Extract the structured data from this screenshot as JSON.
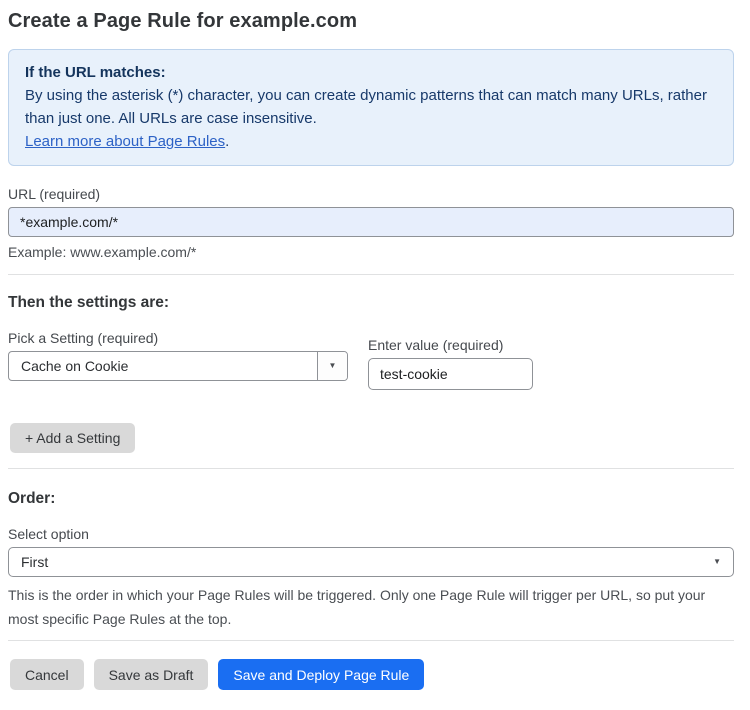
{
  "page": {
    "title": "Create a Page Rule for example.com"
  },
  "info_box": {
    "heading": "If the URL matches:",
    "body": "By using the asterisk (*) character, you can create dynamic patterns that can match many URLs, rather than just one. All URLs are case insensitive.",
    "link_label": "Learn more about Page Rules",
    "link_suffix": "."
  },
  "url_field": {
    "label": "URL (required)",
    "value": "*example.com/*",
    "helper": "Example: www.example.com/*"
  },
  "settings_section": {
    "heading": "Then the settings are:",
    "setting_picker": {
      "label": "Pick a Setting (required)",
      "selected": "Cache on Cookie"
    },
    "value_field": {
      "label": "Enter value (required)",
      "value": "test-cookie"
    },
    "add_setting_label": "+ Add a Setting"
  },
  "order_section": {
    "heading": "Order:",
    "select_label": "Select option",
    "selected": "First",
    "helper": "This is the order in which your Page Rules will be triggered. Only one Page Rule will trigger per URL, so put your most specific Page Rules at the top."
  },
  "footer": {
    "cancel_label": "Cancel",
    "save_draft_label": "Save as Draft",
    "save_deploy_label": "Save and Deploy Page Rule"
  },
  "icons": {
    "dropdown_arrow": "▼"
  },
  "colors": {
    "accent_blue": "#1a6ef2",
    "info_background": "#e8f1fb",
    "info_border": "#bdd3ec",
    "info_text": "#17396a",
    "link_blue": "#2d62c6",
    "autofill_input_background": "#e7eefc",
    "gray_button": "#d9d9d9",
    "input_border": "#8f9297"
  }
}
